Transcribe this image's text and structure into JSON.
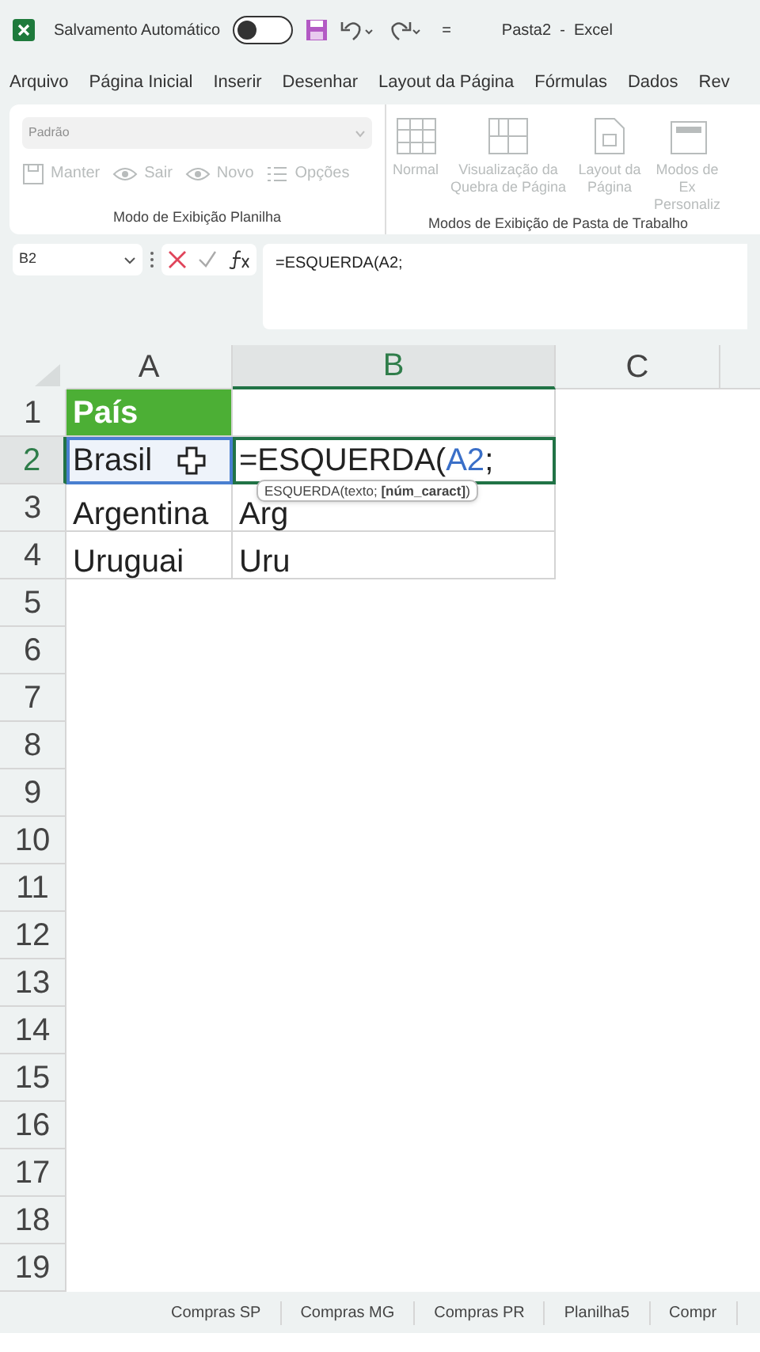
{
  "title_bar": {
    "autosave_label": "Salvamento Automático",
    "autosave_on": false,
    "title": "Pasta2  -  Excel",
    "customize": "="
  },
  "menu": [
    "Arquivo",
    "Página Inicial",
    "Inserir",
    "Desenhar",
    "Layout da Página",
    "Fórmulas",
    "Dados",
    "Rev"
  ],
  "ribbon": {
    "groups": [
      {
        "label": "Modo de Exibição Planilha",
        "dropdown": {
          "value": "Padrão",
          "disabled": true
        },
        "items": [
          {
            "label": "Manter",
            "kind": "save",
            "disabled": true
          },
          {
            "label": "Sair",
            "kind": "eye",
            "disabled": true
          },
          {
            "label": "Novo",
            "kind": "eye",
            "disabled": true
          },
          {
            "label": "Opções",
            "kind": "list",
            "disabled": true
          }
        ]
      },
      {
        "label": "Modos de Exibição de Pasta de Trabalho",
        "items": [
          {
            "label": "Normal",
            "kind": "grid",
            "disabled": true
          },
          {
            "label": "Visualização da Quebra de Página",
            "kind": "break",
            "disabled": true
          },
          {
            "label": "Layout da Página",
            "kind": "page",
            "disabled": true
          },
          {
            "label": "Modos de Ex Personaliz",
            "kind": "custom",
            "disabled": true
          }
        ]
      }
    ]
  },
  "formula_bar": {
    "name_box": "B2",
    "formula": "=ESQUERDA(A2;"
  },
  "columns": [
    {
      "label": "A",
      "selected": false
    },
    {
      "label": "B",
      "selected": true
    },
    {
      "label": "C",
      "selected": false
    }
  ],
  "rows": [
    {
      "number": "1",
      "selected": false,
      "cells": [
        {
          "kind": "header",
          "text": "País"
        },
        {
          "kind": "plain",
          "text": ""
        }
      ]
    },
    {
      "number": "2",
      "selected": true,
      "cells": [
        {
          "kind": "reference",
          "text": "Brasil"
        },
        {
          "kind": "editing",
          "parts": [
            {
              "text": "=ESQUERDA(",
              "kind": "plain"
            },
            {
              "text": "A2",
              "kind": "ref"
            },
            {
              "text": ";",
              "kind": "plain"
            }
          ]
        }
      ]
    },
    {
      "number": "3",
      "selected": false,
      "cells": [
        {
          "kind": "plain",
          "text": "Argentina"
        },
        {
          "kind": "plain",
          "text": "Arg"
        }
      ]
    },
    {
      "number": "4",
      "selected": false,
      "cells": [
        {
          "kind": "plain",
          "text": "Uruguai"
        },
        {
          "kind": "plain",
          "text": "Uru"
        }
      ]
    },
    {
      "number": "5",
      "selected": false
    },
    {
      "number": "6",
      "selected": false
    },
    {
      "number": "7",
      "selected": false
    },
    {
      "number": "8",
      "selected": false
    },
    {
      "number": "9",
      "selected": false
    },
    {
      "number": "10",
      "selected": false
    },
    {
      "number": "11",
      "selected": false
    },
    {
      "number": "12",
      "selected": false
    },
    {
      "number": "13",
      "selected": false
    },
    {
      "number": "14",
      "selected": false
    },
    {
      "number": "15",
      "selected": false
    },
    {
      "number": "16",
      "selected": false
    },
    {
      "number": "17",
      "selected": false
    },
    {
      "number": "18",
      "selected": false
    },
    {
      "number": "19",
      "selected": false
    }
  ],
  "tooltip": "ESQUERDA(texto; **[núm_caract]**)",
  "sheet_tabs": [
    "Compras SP",
    "Compras MG",
    "Compras PR",
    "Planilha5",
    "Compr"
  ]
}
